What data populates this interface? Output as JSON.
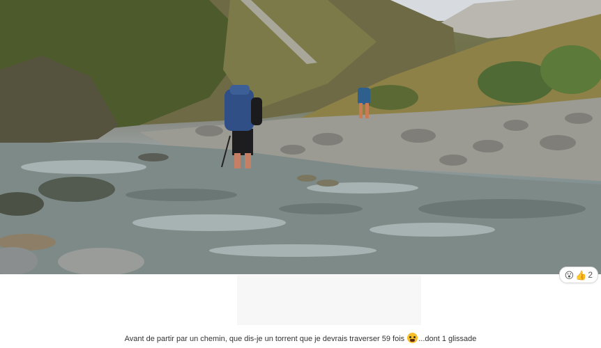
{
  "post": {
    "caption_before": "Avant de partir par un chemin,  que dis-je un torrent que je devrais traverser 59 fois",
    "caption_emoji": "fearful-face-emoji",
    "caption_after": "...dont 1 glissade"
  },
  "reactions": {
    "icons": [
      "😮",
      "👍"
    ],
    "count": "2"
  }
}
